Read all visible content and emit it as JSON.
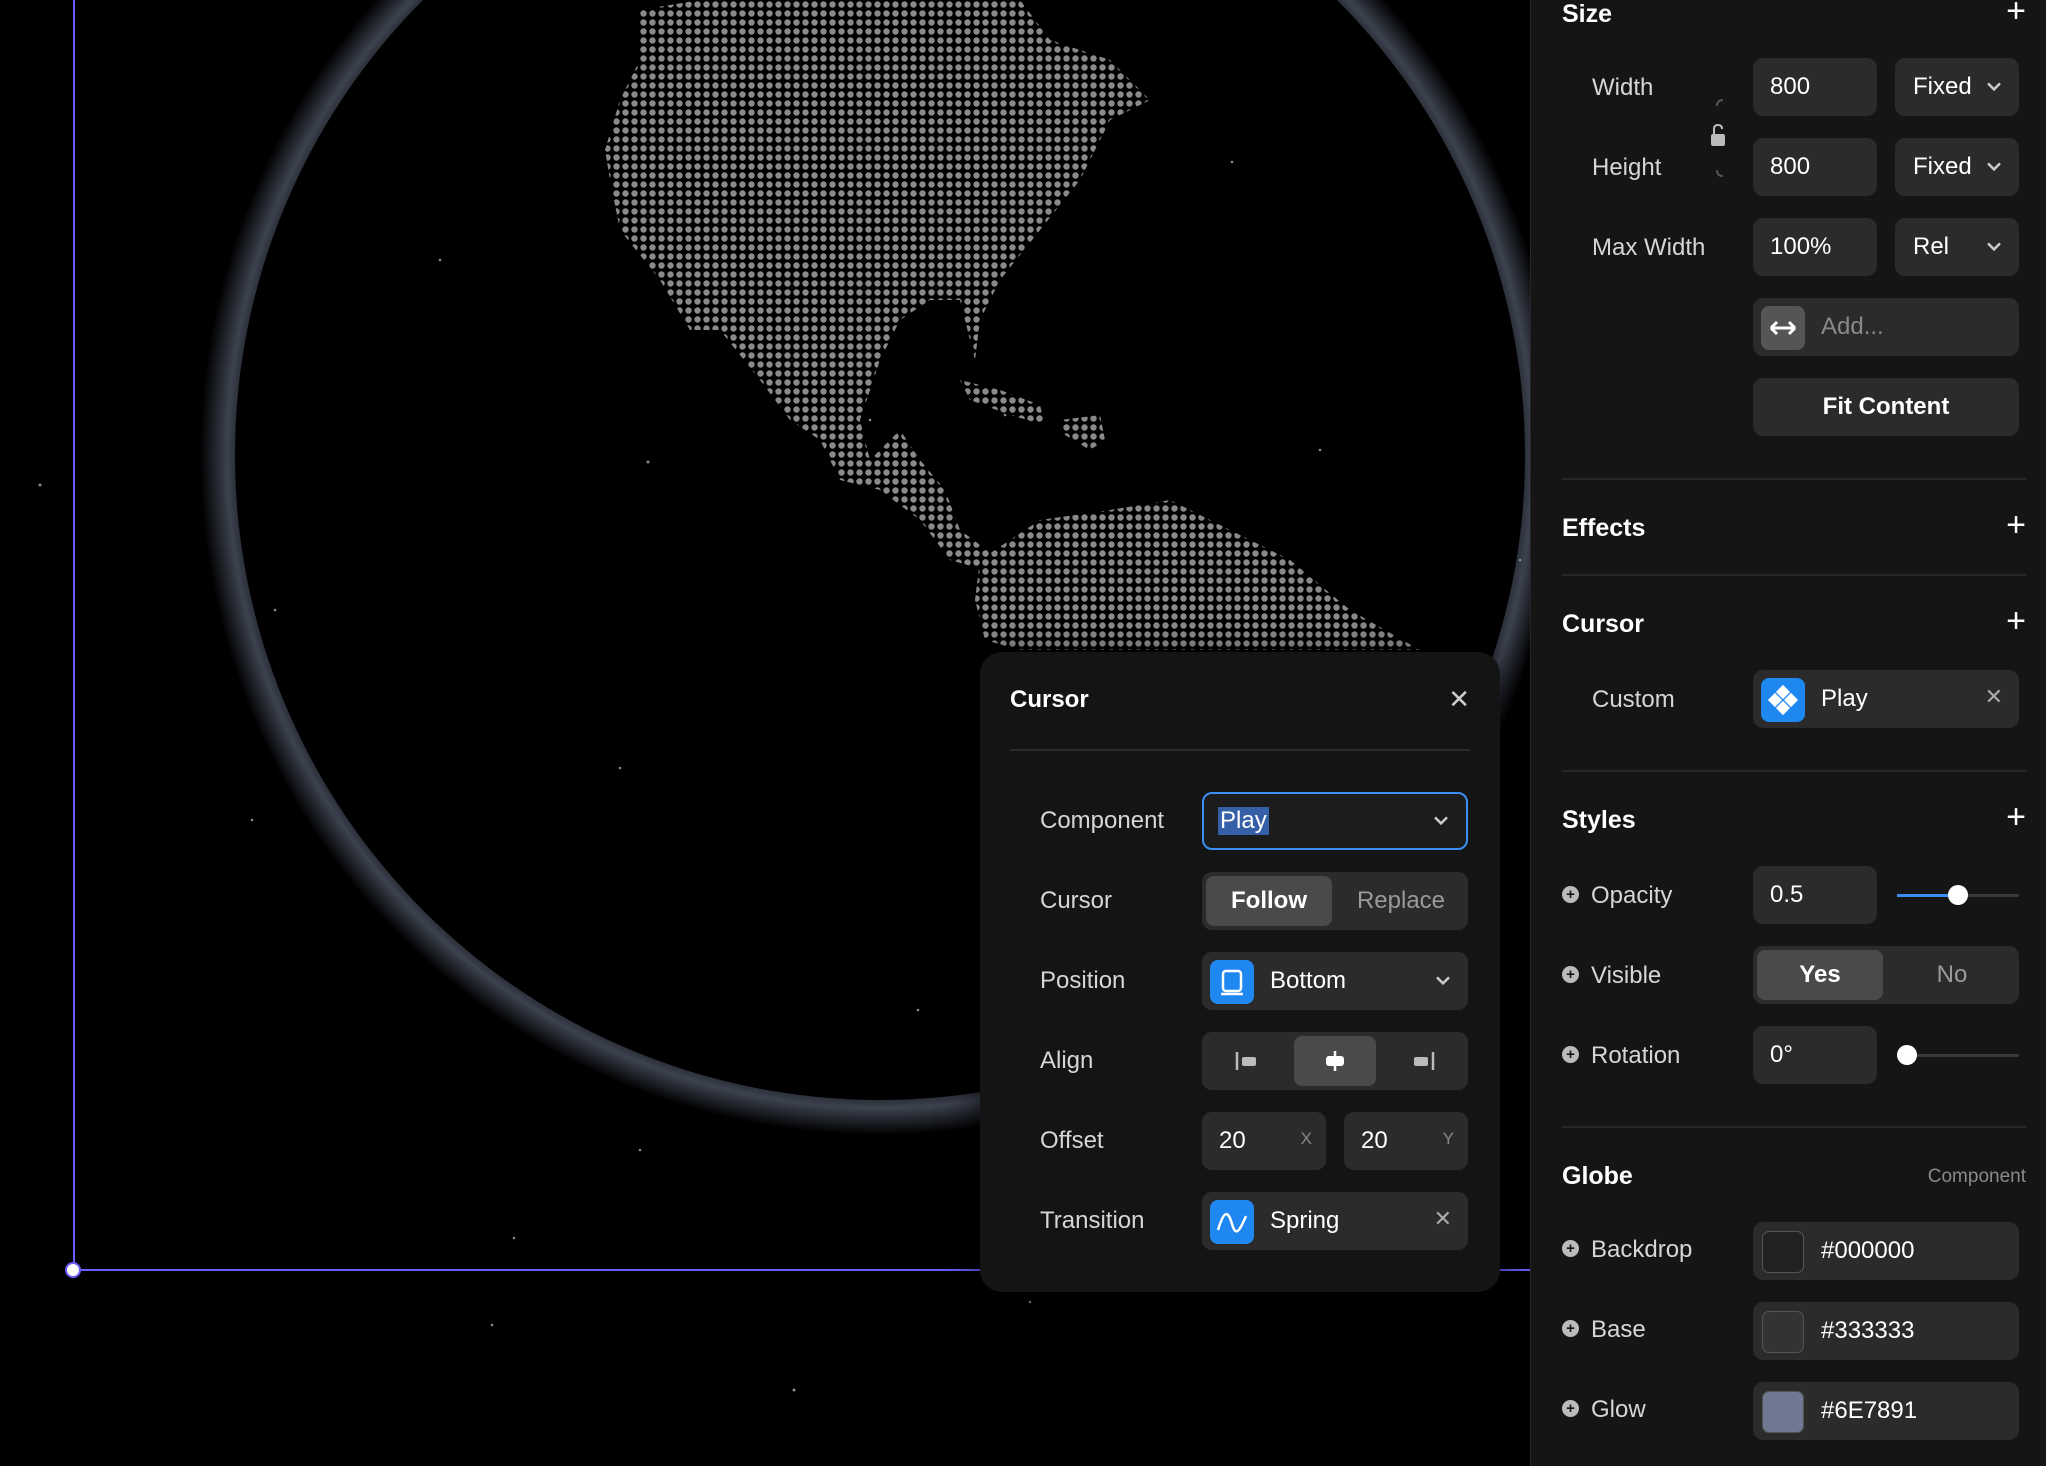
{
  "panel": {
    "size": {
      "title": "Size",
      "width_label": "Width",
      "width_value": "800",
      "width_mode": "Fixed",
      "height_label": "Height",
      "height_value": "800",
      "height_mode": "Fixed",
      "maxwidth_label": "Max Width",
      "maxwidth_value": "100%",
      "maxwidth_mode": "Rel",
      "add_placeholder": "Add...",
      "fit_content": "Fit Content"
    },
    "effects": {
      "title": "Effects"
    },
    "cursor": {
      "title": "Cursor",
      "custom_label": "Custom",
      "custom_value": "Play"
    },
    "styles": {
      "title": "Styles",
      "opacity_label": "Opacity",
      "opacity_value": "0.5",
      "opacity_level": 0.5,
      "visible_label": "Visible",
      "visible_yes": "Yes",
      "visible_no": "No",
      "rotation_label": "Rotation",
      "rotation_value": "0°",
      "rotation_level": 0
    },
    "globe": {
      "title": "Globe",
      "tag": "Component",
      "backdrop_label": "Backdrop",
      "backdrop_value": "#000000",
      "backdrop_color": "#000000",
      "base_label": "Base",
      "base_value": "#333333",
      "base_color": "#333333",
      "glow_label": "Glow",
      "glow_value": "#6E7891",
      "glow_color": "#6E7891"
    }
  },
  "modal": {
    "title": "Cursor",
    "component_label": "Component",
    "component_value": "Play",
    "cursor_label": "Cursor",
    "cursor_follow": "Follow",
    "cursor_replace": "Replace",
    "position_label": "Position",
    "position_value": "Bottom",
    "align_label": "Align",
    "offset_label": "Offset",
    "offset_x": "20",
    "offset_x_tag": "X",
    "offset_y": "20",
    "offset_y_tag": "Y",
    "transition_label": "Transition",
    "transition_value": "Spring"
  },
  "colors": {
    "accent": "#1e87f0",
    "selection": "#6b5cff",
    "panel_bg": "#151515"
  }
}
